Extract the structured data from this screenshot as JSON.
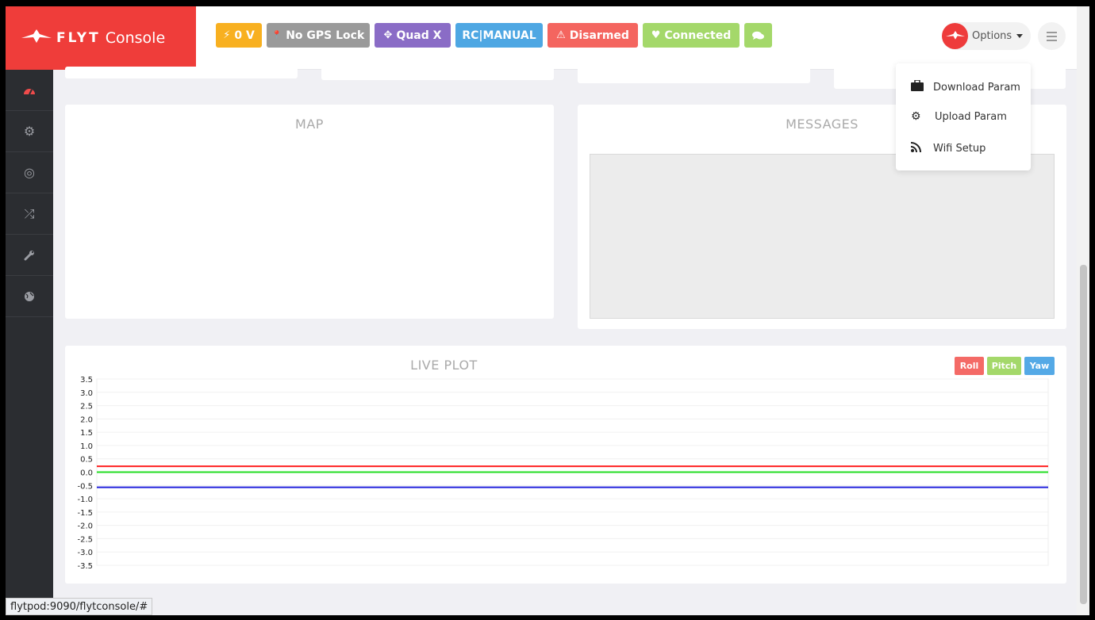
{
  "brand": {
    "word1": "FLYT",
    "word2": "Console"
  },
  "badges": [
    {
      "icon": "⚡",
      "label": "0 V",
      "color": "#f8b020"
    },
    {
      "icon": "📍",
      "label": "No GPS Lock",
      "color": "#9a9a9a"
    },
    {
      "icon": "✥",
      "label": "Quad X",
      "color": "#8a6cc6"
    },
    {
      "icon": "",
      "label": "RC|MANUAL",
      "color": "#4ea7e3"
    },
    {
      "icon": "⚠",
      "label": "Disarmed",
      "color": "#f4655f"
    },
    {
      "icon": "♥",
      "label": "Connected",
      "color": "#a4d86a"
    },
    {
      "icon": "💬",
      "label": "",
      "color": "#a4d86a"
    }
  ],
  "options": {
    "label": "Options"
  },
  "dropdown": {
    "items": [
      {
        "icon": "briefcase-icon",
        "label": "Download Param"
      },
      {
        "icon": "gear-icon",
        "label": "Upload Param"
      },
      {
        "icon": "rss-icon",
        "label": "Wifi Setup"
      }
    ]
  },
  "sidebar": {
    "items": [
      "dashboard-icon",
      "gear-icon",
      "target-icon",
      "shuffle-icon",
      "wrench-icon",
      "globe-icon"
    ]
  },
  "map": {
    "title": "MAP"
  },
  "messages": {
    "title": "MESSAGES"
  },
  "plot": {
    "title": "LIVE PLOT",
    "buttons": [
      {
        "label": "Roll",
        "color": "#f46a66"
      },
      {
        "label": "Pitch",
        "color": "#a4d86a"
      },
      {
        "label": "Yaw",
        "color": "#54a9e6"
      }
    ]
  },
  "chart_data": {
    "type": "line",
    "title": "LIVE PLOT",
    "ylim": [
      -3.5,
      3.5
    ],
    "yticks": [
      "3.5",
      "3.0",
      "2.5",
      "2.0",
      "1.5",
      "1.0",
      "0.5",
      "0.0",
      "-0.5",
      "-1.0",
      "-1.5",
      "-2.0",
      "-2.5",
      "-3.0",
      "-3.5"
    ],
    "grid": true,
    "series": [
      {
        "name": "Roll",
        "color": "#ff2020",
        "values": [
          0.22,
          0.22
        ]
      },
      {
        "name": "Pitch",
        "color": "#22dd22",
        "values": [
          0.0,
          0.0
        ]
      },
      {
        "name": "Yaw",
        "color": "#2222dd",
        "values": [
          -0.57,
          -0.57
        ]
      }
    ]
  },
  "statusbar": {
    "url": "flytpod:9090/flytconsole/#"
  }
}
